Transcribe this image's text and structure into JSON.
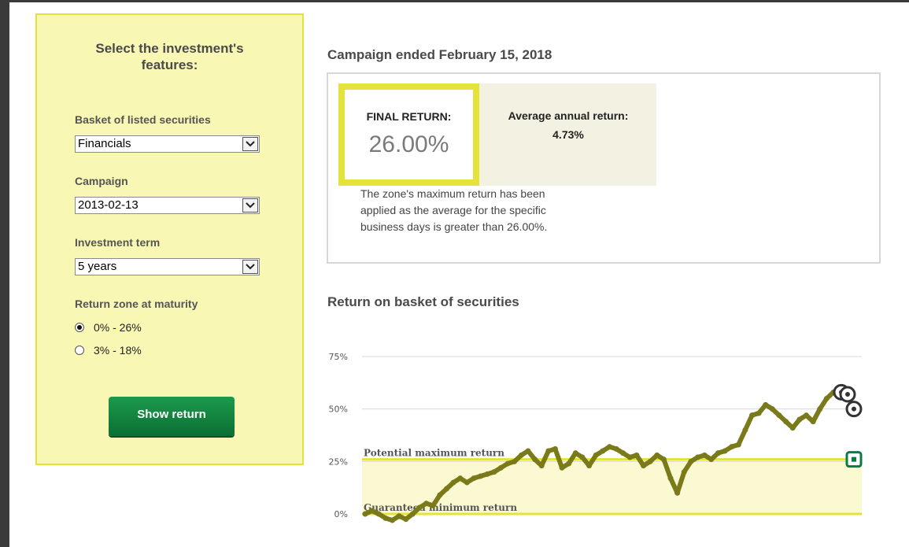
{
  "panel": {
    "title": "Select the investment's features:",
    "basket_label": "Basket of listed securities",
    "basket_value": "Financials",
    "campaign_label": "Campaign",
    "campaign_value": "2013-02-13",
    "term_label": "Investment term",
    "term_value": "5 years",
    "zone_label": "Return zone at maturity",
    "zones": [
      {
        "label": "0% - 26%",
        "checked": true
      },
      {
        "label": "3% - 18%",
        "checked": false
      }
    ],
    "show_button": "Show return"
  },
  "result": {
    "heading": "Campaign ended February 15, 2018",
    "final_label": "FINAL RETURN:",
    "final_value": "26.00%",
    "avg_label": "Average annual return:",
    "avg_value": "4.73%",
    "note": "The zone's maximum return has been applied as the average for the specific business days is greater than 26.00%."
  },
  "chart_heading": "Return on basket of securities",
  "colors": {
    "series": "#7a7a1a",
    "zone_fill": "#fbf9d2",
    "zone_line": "#e6e23c",
    "marker_green": "#0b7a45"
  },
  "chart_data": {
    "type": "line",
    "ylim": [
      0,
      75
    ],
    "y_ticks": [
      "0%",
      "25%",
      "50%",
      "75%"
    ],
    "y_tick_values": [
      0,
      25,
      50,
      75
    ],
    "bands": [
      {
        "label": "Potential maximum return",
        "value": 26
      },
      {
        "label": "Guaranteed minimum return",
        "value": 0
      }
    ],
    "series": [
      {
        "values": [
          0,
          1.5,
          0,
          -2,
          -3,
          -1,
          -2.5,
          0,
          3,
          5,
          4,
          9,
          12,
          15,
          17,
          15,
          17,
          18,
          19,
          20,
          22,
          24,
          25,
          28,
          30,
          26,
          23,
          30,
          31,
          22,
          24,
          29,
          27,
          23,
          28,
          30,
          32,
          31,
          29,
          27,
          28,
          23,
          25,
          28,
          26,
          17,
          10,
          20,
          25,
          27,
          28,
          26,
          29,
          30,
          32,
          33,
          40,
          47,
          48,
          52,
          50,
          47,
          44,
          41,
          45,
          47,
          44,
          50,
          55,
          58
        ]
      }
    ],
    "markers": [
      {
        "value": 58,
        "shape": "ring"
      },
      {
        "value": 57,
        "shape": "ring"
      },
      {
        "value": 50,
        "shape": "ring"
      },
      {
        "value": 26,
        "shape": "square"
      }
    ]
  }
}
